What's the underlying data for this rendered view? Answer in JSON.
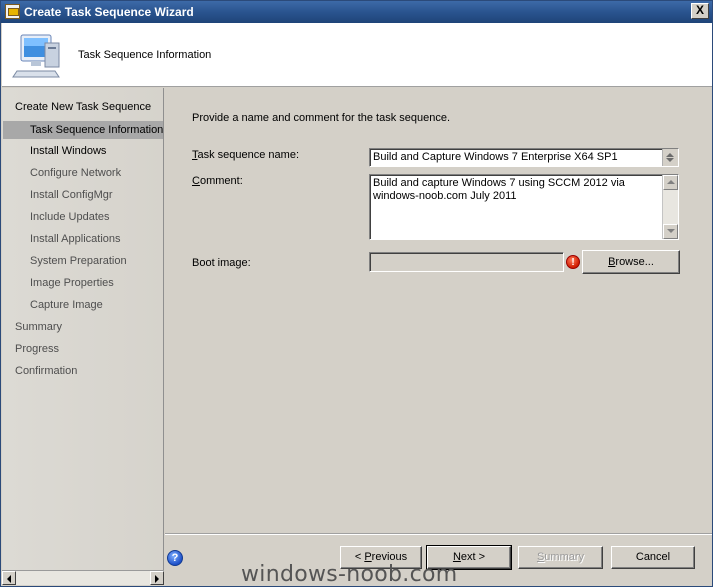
{
  "window": {
    "title": "Create Task Sequence Wizard",
    "close_label": "X"
  },
  "header": {
    "title": "Task Sequence Information"
  },
  "nav": {
    "items": [
      {
        "label": "Create New Task Sequence",
        "state": "done"
      },
      {
        "label": "Task Sequence Information",
        "state": "current"
      },
      {
        "label": "Install Windows",
        "state": "done"
      },
      {
        "label": "Configure Network",
        "state": "pending"
      },
      {
        "label": "Install ConfigMgr",
        "state": "pending"
      },
      {
        "label": "Include Updates",
        "state": "pending"
      },
      {
        "label": "Install Applications",
        "state": "pending"
      },
      {
        "label": "System Preparation",
        "state": "pending"
      },
      {
        "label": "Image Properties",
        "state": "pending"
      },
      {
        "label": "Capture Image",
        "state": "pending"
      },
      {
        "label": "Summary",
        "state": "pending"
      },
      {
        "label": "Progress",
        "state": "pending"
      },
      {
        "label": "Confirmation",
        "state": "pending"
      }
    ]
  },
  "content": {
    "instructions": "Provide a name and comment for the task sequence.",
    "name_label_accel": "T",
    "name_label_rest": "ask sequence name:",
    "name_value": "Build and Capture Windows 7 Enterprise X64 SP1",
    "comment_label_accel": "C",
    "comment_label_rest": "omment:",
    "comment_value": "Build and capture Windows 7 using SCCM 2012 via windows-noob.com July 2011",
    "boot_label": "Boot image:",
    "boot_value": "",
    "error_glyph": "!",
    "browse_accel": "B",
    "browse_rest": "rowse..."
  },
  "buttons": {
    "previous_prefix": "< ",
    "previous_accel": "P",
    "previous_rest": "revious",
    "next_accel": "N",
    "next_rest": "ext >",
    "summary_accel": "S",
    "summary_rest": "ummary",
    "cancel": "Cancel"
  },
  "help_glyph": "?",
  "watermark": "windows-noob.com",
  "colors": {
    "titlebar": "#2a548f",
    "nav_selected": "#a8a8a8",
    "dialog_face": "#d4d0c8",
    "error": "#d01c00"
  }
}
